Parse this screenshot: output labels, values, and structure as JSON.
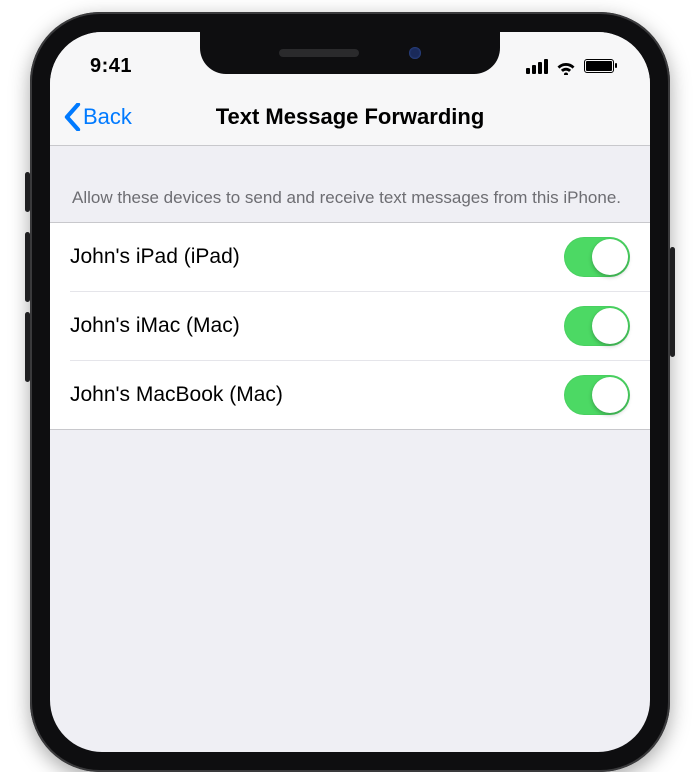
{
  "status": {
    "time": "9:41"
  },
  "nav": {
    "back_label": "Back",
    "title": "Text Message Forwarding"
  },
  "section": {
    "header": "Allow these devices to send and receive text messages from this iPhone."
  },
  "devices": [
    {
      "label": "John's iPad (iPad)",
      "on": true
    },
    {
      "label": "John's iMac (Mac)",
      "on": true
    },
    {
      "label": "John's MacBook (Mac)",
      "on": true
    }
  ]
}
